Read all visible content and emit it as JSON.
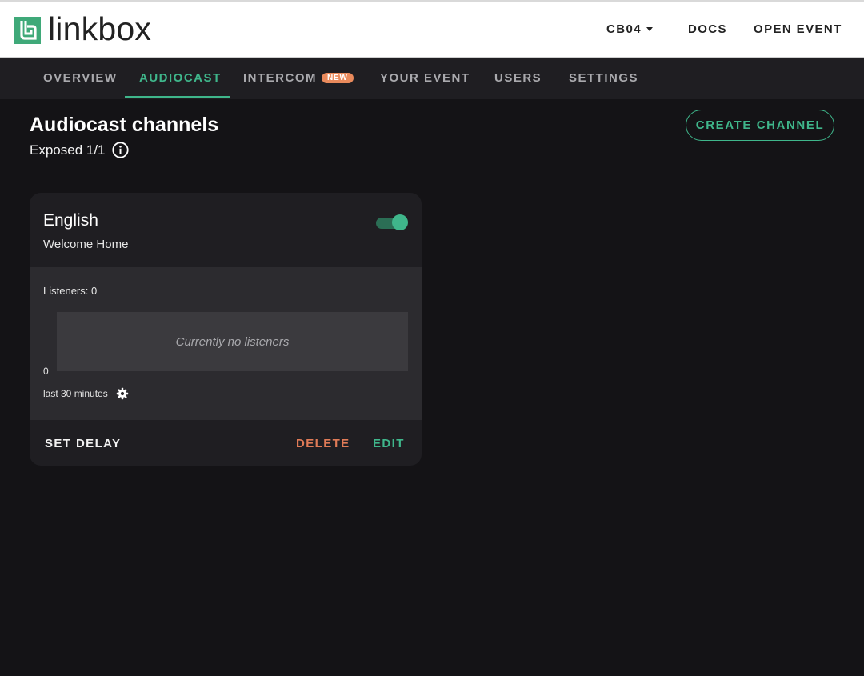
{
  "header": {
    "brand": "linkbox",
    "org_menu": "CB04",
    "docs": "DOCS",
    "open_event": "OPEN EVENT"
  },
  "tabs": [
    {
      "label": "OVERVIEW"
    },
    {
      "label": "AUDIOCAST",
      "active": true
    },
    {
      "label": "INTERCOM",
      "badge": "NEW"
    },
    {
      "label": "YOUR EVENT"
    },
    {
      "label": "USERS"
    },
    {
      "label": "SETTINGS"
    }
  ],
  "page": {
    "title": "Audiocast channels",
    "exposed": "Exposed 1/1",
    "create_button": "CREATE CHANNEL"
  },
  "channel": {
    "name": "English",
    "description": "Welcome Home",
    "enabled": true,
    "listeners_label": "Listeners: 0",
    "chart_empty_text": "Currently no listeners",
    "y_axis_zero": "0",
    "range_label": "last 30 minutes",
    "set_delay": "SET DELAY",
    "delete": "DELETE",
    "edit": "EDIT"
  },
  "colors": {
    "accent": "#3fb68b",
    "danger": "#e07b57",
    "badge": "#e98a5c",
    "background": "#141316",
    "surface": "#1f1e22"
  },
  "icons": [
    "linkbox-logo-icon",
    "chevron-down-icon",
    "info-icon",
    "gear-icon",
    "toggle-switch"
  ]
}
